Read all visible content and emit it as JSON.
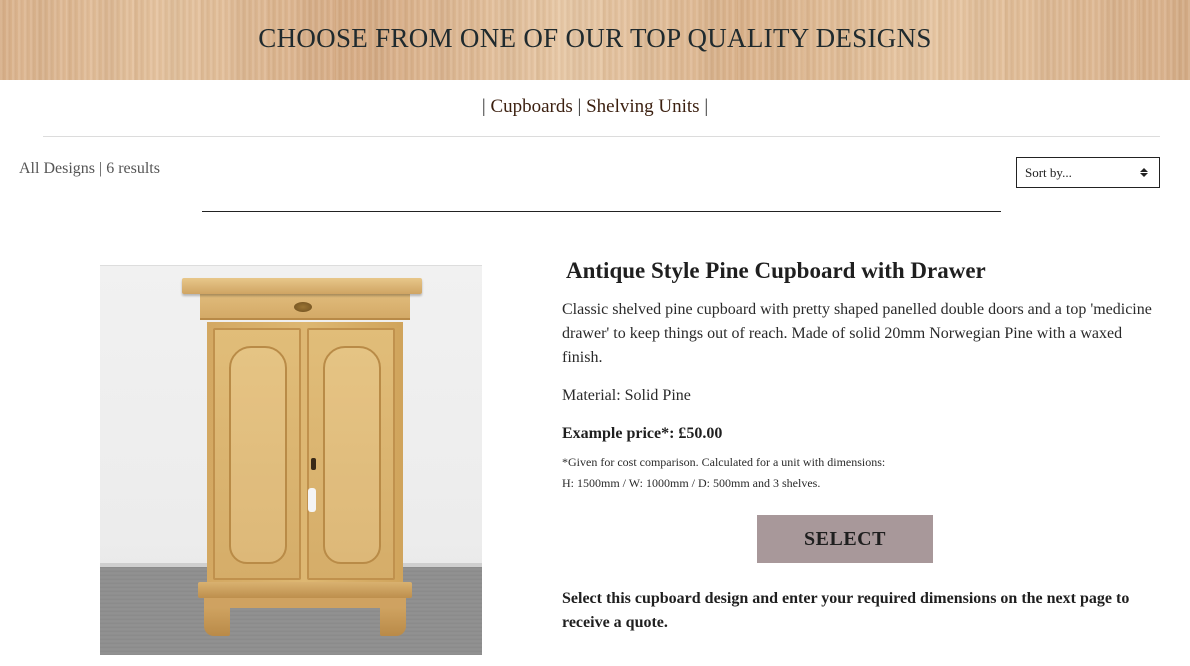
{
  "banner": {
    "title": "CHOOSE FROM ONE OF OUR TOP QUALITY DESIGNS"
  },
  "category_nav": {
    "separator": "|",
    "items": [
      {
        "label": "Cupboards"
      },
      {
        "label": "Shelving Units"
      }
    ]
  },
  "results": {
    "summary": "All Designs | 6 results"
  },
  "sort": {
    "selected": "Sort by..."
  },
  "product": {
    "title": "Antique Style Pine Cupboard with Drawer",
    "description": "Classic shelved pine cupboard with pretty shaped panelled double doors and a top 'medicine drawer' to keep things out of reach. Made of solid 20mm Norwegian Pine with a waxed finish.",
    "material": "Material: Solid Pine",
    "price": "Example price*: £50.00",
    "price_note_line1": "*Given for cost comparison. Calculated for a unit with dimensions:",
    "price_note_line2": "H: 1500mm / W: 1000mm / D: 500mm and 3 shelves.",
    "select_label": "SELECT",
    "select_note": "Select this cupboard design and enter your required dimensions on the next page to receive a quote."
  },
  "colors": {
    "select_button_bg": "#a8989a",
    "category_link": "#3b1f0f"
  },
  "icons": {
    "sort_arrows": "up-down-caret-icon"
  }
}
